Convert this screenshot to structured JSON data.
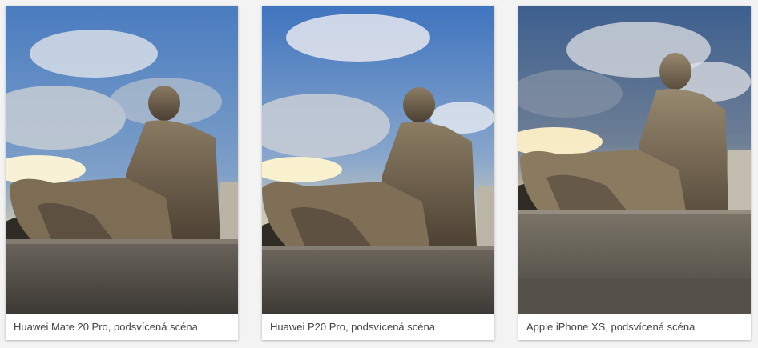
{
  "gallery": {
    "items": [
      {
        "caption": "Huawei Mate 20 Pro, podsvícená scéna"
      },
      {
        "caption": "Huawei P20 Pro, podsvícená scéna"
      },
      {
        "caption": "Apple iPhone XS, podsvícená scéna"
      }
    ]
  }
}
